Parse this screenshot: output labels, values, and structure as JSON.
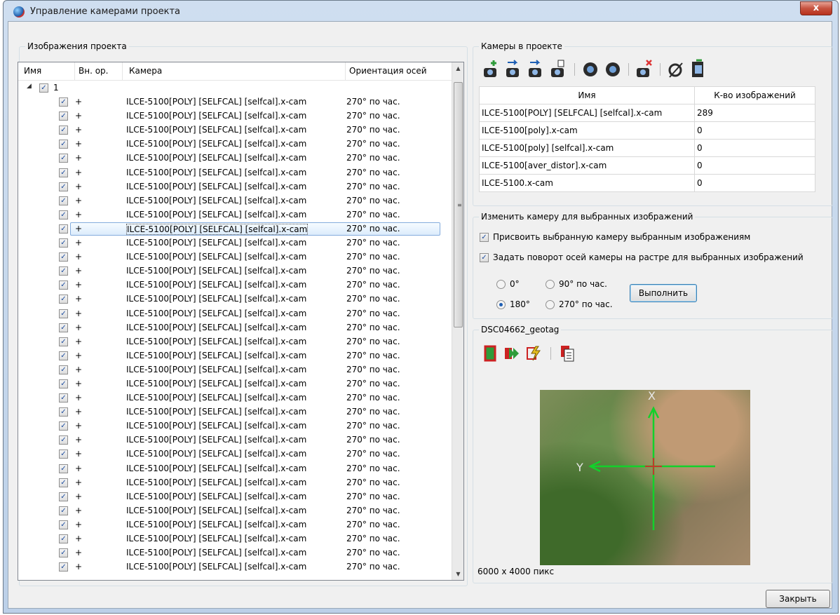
{
  "window": {
    "title": "Управление камерами проекта",
    "close_glyph": "x"
  },
  "left": {
    "group_title": "Изображения проекта",
    "columns": [
      "Имя",
      "Вн. ор.",
      "Камера",
      "Ориентация осей"
    ],
    "root": {
      "label": "1"
    },
    "rows": [
      {
        "int": "+",
        "camera": "ILCE-5100[POLY] [SELFCAL] [selfcal].x-cam",
        "orient": "270° по час."
      },
      {
        "int": "+",
        "camera": "ILCE-5100[POLY] [SELFCAL] [selfcal].x-cam",
        "orient": "270° по час."
      },
      {
        "int": "+",
        "camera": "ILCE-5100[POLY] [SELFCAL] [selfcal].x-cam",
        "orient": "270° по час."
      },
      {
        "int": "+",
        "camera": "ILCE-5100[POLY] [SELFCAL] [selfcal].x-cam",
        "orient": "270° по час."
      },
      {
        "int": "+",
        "camera": "ILCE-5100[POLY] [SELFCAL] [selfcal].x-cam",
        "orient": "270° по час."
      },
      {
        "int": "+",
        "camera": "ILCE-5100[POLY] [SELFCAL] [selfcal].x-cam",
        "orient": "270° по час."
      },
      {
        "int": "+",
        "camera": "ILCE-5100[POLY] [SELFCAL] [selfcal].x-cam",
        "orient": "270° по час."
      },
      {
        "int": "+",
        "camera": "ILCE-5100[POLY] [SELFCAL] [selfcal].x-cam",
        "orient": "270° по час."
      },
      {
        "int": "+",
        "camera": "ILCE-5100[POLY] [SELFCAL] [selfcal].x-cam",
        "orient": "270° по час."
      },
      {
        "int": "+",
        "camera": "ILCE-5100[POLY] [SELFCAL] [selfcal].x-cam",
        "orient": "270° по час.",
        "selected": true
      },
      {
        "int": "+",
        "camera": "ILCE-5100[POLY] [SELFCAL] [selfcal].x-cam",
        "orient": "270° по час."
      },
      {
        "int": "+",
        "camera": "ILCE-5100[POLY] [SELFCAL] [selfcal].x-cam",
        "orient": "270° по час."
      },
      {
        "int": "+",
        "camera": "ILCE-5100[POLY] [SELFCAL] [selfcal].x-cam",
        "orient": "270° по час."
      },
      {
        "int": "+",
        "camera": "ILCE-5100[POLY] [SELFCAL] [selfcal].x-cam",
        "orient": "270° по час."
      },
      {
        "int": "+",
        "camera": "ILCE-5100[POLY] [SELFCAL] [selfcal].x-cam",
        "orient": "270° по час."
      },
      {
        "int": "+",
        "camera": "ILCE-5100[POLY] [SELFCAL] [selfcal].x-cam",
        "orient": "270° по час."
      },
      {
        "int": "+",
        "camera": "ILCE-5100[POLY] [SELFCAL] [selfcal].x-cam",
        "orient": "270° по час."
      },
      {
        "int": "+",
        "camera": "ILCE-5100[POLY] [SELFCAL] [selfcal].x-cam",
        "orient": "270° по час."
      },
      {
        "int": "+",
        "camera": "ILCE-5100[POLY] [SELFCAL] [selfcal].x-cam",
        "orient": "270° по час."
      },
      {
        "int": "+",
        "camera": "ILCE-5100[POLY] [SELFCAL] [selfcal].x-cam",
        "orient": "270° по час."
      },
      {
        "int": "+",
        "camera": "ILCE-5100[POLY] [SELFCAL] [selfcal].x-cam",
        "orient": "270° по час."
      },
      {
        "int": "+",
        "camera": "ILCE-5100[POLY] [SELFCAL] [selfcal].x-cam",
        "orient": "270° по час."
      },
      {
        "int": "+",
        "camera": "ILCE-5100[POLY] [SELFCAL] [selfcal].x-cam",
        "orient": "270° по час."
      },
      {
        "int": "+",
        "camera": "ILCE-5100[POLY] [SELFCAL] [selfcal].x-cam",
        "orient": "270° по час."
      },
      {
        "int": "+",
        "camera": "ILCE-5100[POLY] [SELFCAL] [selfcal].x-cam",
        "orient": "270° по час."
      },
      {
        "int": "+",
        "camera": "ILCE-5100[POLY] [SELFCAL] [selfcal].x-cam",
        "orient": "270° по час."
      },
      {
        "int": "+",
        "camera": "ILCE-5100[POLY] [SELFCAL] [selfcal].x-cam",
        "orient": "270° по час."
      },
      {
        "int": "+",
        "camera": "ILCE-5100[POLY] [SELFCAL] [selfcal].x-cam",
        "orient": "270° по час."
      },
      {
        "int": "+",
        "camera": "ILCE-5100[POLY] [SELFCAL] [selfcal].x-cam",
        "orient": "270° по час."
      },
      {
        "int": "+",
        "camera": "ILCE-5100[POLY] [SELFCAL] [selfcal].x-cam",
        "orient": "270° по час."
      },
      {
        "int": "+",
        "camera": "ILCE-5100[POLY] [SELFCAL] [selfcal].x-cam",
        "orient": "270° по час."
      },
      {
        "int": "+",
        "camera": "ILCE-5100[POLY] [SELFCAL] [selfcal].x-cam",
        "orient": "270° по час."
      },
      {
        "int": "+",
        "camera": "ILCE-5100[POLY] [SELFCAL] [selfcal].x-cam",
        "orient": "270° по час."
      },
      {
        "int": "+",
        "camera": "ILCE-5100[POLY] [SELFCAL] [selfcal].x-cam",
        "orient": "270° по час."
      }
    ]
  },
  "cameras": {
    "group_title": "Камеры в проекте",
    "columns": [
      "Имя",
      "К-во изображений"
    ],
    "rows": [
      {
        "name": "ILCE-5100[POLY] [SELFCAL] [selfcal].x-cam",
        "count": "289"
      },
      {
        "name": "ILCE-5100[poly].x-cam",
        "count": "0"
      },
      {
        "name": "ILCE-5100[poly] [selfcal].x-cam",
        "count": "0"
      },
      {
        "name": "ILCE-5100[aver_distor].x-cam",
        "count": "0"
      },
      {
        "name": "ILCE-5100.x-cam",
        "count": "0"
      }
    ]
  },
  "change": {
    "group_title": "Изменить камеру для выбранных изображений",
    "assign_label": "Присвоить выбранную камеру выбранным изображениям",
    "rotate_label": "Задать поворот осей камеры на растре для выбранных изображений",
    "r0": "0°",
    "r90": "90° по час.",
    "r180": "180°",
    "r270": "270° по час.",
    "selected_rotation": "180°",
    "run_label": "Выполнить"
  },
  "preview": {
    "group_title": "DSC04662_geotag",
    "x_axis": "X",
    "y_axis": "Y",
    "size_label": "6000 x 4000 пикс"
  },
  "footer": {
    "close_label": "Закрыть"
  },
  "colors": {
    "accent": "#1e5fb4",
    "selection": "#dcecfc",
    "axis": "#12d12b",
    "center": "#c0392b"
  }
}
